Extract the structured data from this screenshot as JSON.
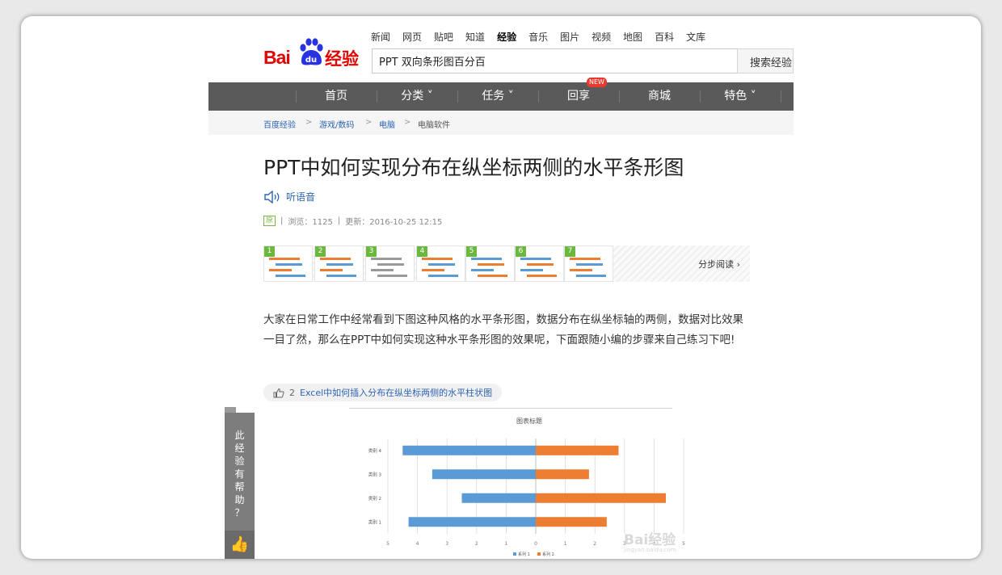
{
  "logo": {
    "brand": "Bai",
    "brand_du": "du",
    "product": "经验"
  },
  "topnav": [
    "新闻",
    "网页",
    "贴吧",
    "知道",
    "经验",
    "音乐",
    "图片",
    "视频",
    "地图",
    "百科",
    "文库"
  ],
  "topnav_active": "经验",
  "search": {
    "value": "PPT 双向条形图百分百",
    "button": "搜索经验"
  },
  "mainnav": [
    {
      "label": "首页"
    },
    {
      "label": "分类 ˅"
    },
    {
      "label": "任务 ˅"
    },
    {
      "label": "回享"
    },
    {
      "label": "商城"
    },
    {
      "label": "特色 ˅"
    }
  ],
  "new_badge": "NEW",
  "breadcrumb": {
    "items": [
      "百度经验",
      "游戏/数码",
      "电脑"
    ],
    "current": "电脑软件",
    "sep": ">"
  },
  "article": {
    "title": "PPT中如何实现分布在纵坐标两侧的水平条形图",
    "listen": "听语音",
    "original_badge": "原",
    "views": "浏览：1125",
    "updated": "更新：2016-10-25 12:15",
    "steps_more": "分步阅读 ›",
    "step_numbers": [
      "1",
      "2",
      "3",
      "4",
      "5",
      "6",
      "7"
    ],
    "intro": "大家在日常工作中经常看到下图这种风格的水平条形图，数据分布在纵坐标轴的两侧，数据对比效果一目了然，那么在PPT中如何实现这种水平条形图的效果呢，下面跟随小编的步骤来自己练习下吧!",
    "related_count": "2",
    "related_link": "Excel中如何插入分布在纵坐标两侧的水平柱状图"
  },
  "side_helpful": {
    "text": "此经验有帮助？"
  },
  "watermark": {
    "line1": "Bai经验",
    "line2": "jingyan.baidu.com"
  },
  "colors": {
    "brand_red": "#e10601",
    "link_blue": "#2d64b3",
    "nav_gray": "#5a5a5a",
    "series1": "#5b9bd5",
    "series2": "#ed7d31"
  },
  "chart_data": {
    "type": "bar",
    "orientation": "horizontal",
    "title": "图表标题",
    "categories": [
      "类别 1",
      "类别 2",
      "类别 3",
      "类别 4"
    ],
    "series": [
      {
        "name": "系列 1",
        "values": [
          -4.3,
          -2.5,
          -3.5,
          -4.5
        ]
      },
      {
        "name": "系列 2",
        "values": [
          2.4,
          4.4,
          1.8,
          2.8
        ]
      }
    ],
    "xlim": [
      -5,
      5
    ],
    "xticks": [
      "5",
      "4",
      "3",
      "2",
      "1",
      "0",
      "1",
      "2",
      "3",
      "4",
      "5"
    ],
    "grid": true,
    "legend": "bottom"
  }
}
